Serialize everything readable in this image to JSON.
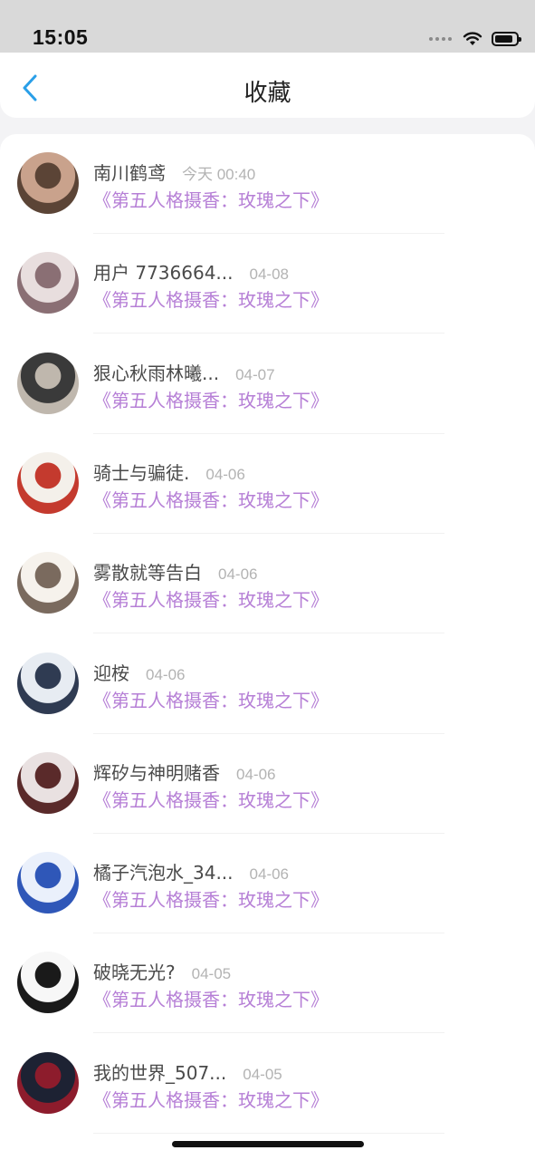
{
  "status_bar": {
    "time": "15:05"
  },
  "nav": {
    "title": "收藏"
  },
  "items": [
    {
      "name": "南川鹤鸢",
      "time": "今天 00:40",
      "subtitle": "《第五人格摄香：玫瑰之下》",
      "avatar_colors": [
        "#c9a28c",
        "#5b4436"
      ]
    },
    {
      "name": "用户 7736664...",
      "time": "04-08",
      "subtitle": "《第五人格摄香：玫瑰之下》",
      "avatar_colors": [
        "#e8dede",
        "#8a6f74"
      ]
    },
    {
      "name": "狠心秋雨林曦...",
      "time": "04-07",
      "subtitle": "《第五人格摄香：玫瑰之下》",
      "avatar_colors": [
        "#3a3a3a",
        "#bfb7ad"
      ]
    },
    {
      "name": "骑士与骗徒.",
      "time": "04-06",
      "subtitle": "《第五人格摄香：玫瑰之下》",
      "avatar_colors": [
        "#f4f0ea",
        "#c43a2e"
      ]
    },
    {
      "name": "雾散就等告白",
      "time": "04-06",
      "subtitle": "《第五人格摄香：玫瑰之下》",
      "avatar_colors": [
        "#f6f2ec",
        "#7a6a5e"
      ]
    },
    {
      "name": "迎桉",
      "time": "04-06",
      "subtitle": "《第五人格摄香：玫瑰之下》",
      "avatar_colors": [
        "#e7ecf2",
        "#2f3b52"
      ]
    },
    {
      "name": "辉矽与神明赌香",
      "time": "04-06",
      "subtitle": "《第五人格摄香：玫瑰之下》",
      "avatar_colors": [
        "#e9e1e1",
        "#5a2a2a"
      ]
    },
    {
      "name": "橘子汽泡水_34...",
      "time": "04-06",
      "subtitle": "《第五人格摄香：玫瑰之下》",
      "avatar_colors": [
        "#eaf0fb",
        "#2f57b8"
      ]
    },
    {
      "name": "破晓无光?",
      "time": "04-05",
      "subtitle": "《第五人格摄香：玫瑰之下》",
      "avatar_colors": [
        "#f7f7f7",
        "#1a1a1a"
      ]
    },
    {
      "name": "我的世界_507...",
      "time": "04-05",
      "subtitle": "《第五人格摄香：玫瑰之下》",
      "avatar_colors": [
        "#1d2233",
        "#8d1c2c"
      ]
    }
  ],
  "icons": {
    "back": "chevron-left-icon",
    "wifi": "wifi-icon",
    "battery": "battery-icon",
    "signal": "signal-dots-icon"
  },
  "colors": {
    "accent_blue": "#2a9fe8",
    "subtitle_purple": "#b67fd6"
  }
}
